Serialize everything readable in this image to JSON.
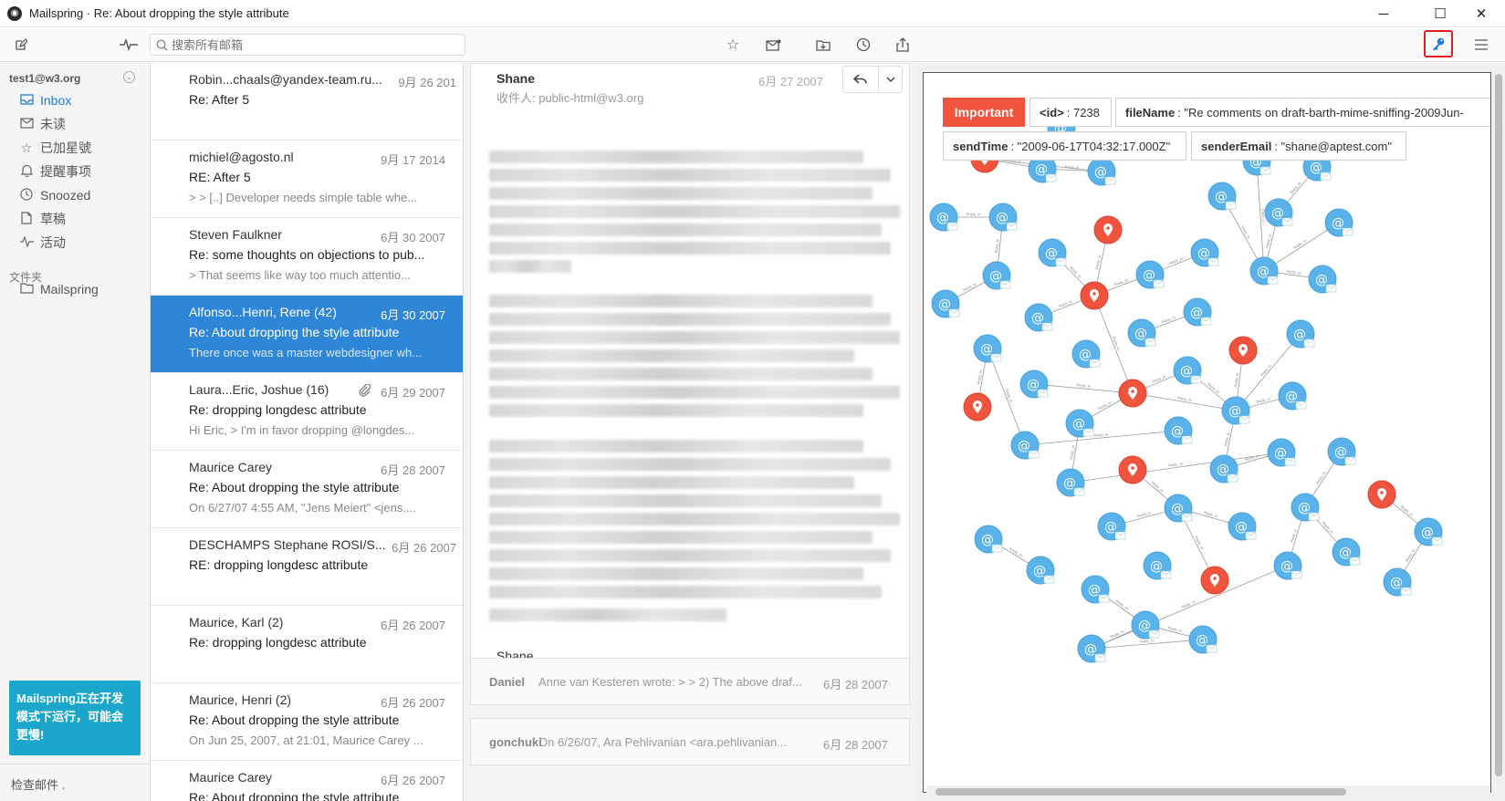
{
  "window": {
    "title": "Mailspring · Re: About dropping the style attribute",
    "minimize": "─",
    "maximize": "☐",
    "close": "✕"
  },
  "toolbar": {
    "compose_icon": "compose-icon",
    "activity_icon": "activity-icon",
    "search_placeholder": "搜索所有邮箱",
    "star_icon": "star-icon",
    "mail_icon": "mail-icon",
    "folder_icon": "folder-icon",
    "clock_icon": "clock-icon",
    "share_icon": "share-icon",
    "key_icon": "key-icon",
    "menu_icon": "menu-icon"
  },
  "sidebar": {
    "account": "test1@w3.org",
    "items": [
      {
        "label": "Inbox",
        "icon": "inbox-icon",
        "active": true
      },
      {
        "label": "未读",
        "icon": "unread-icon"
      },
      {
        "label": "已加星號",
        "icon": "star-icon"
      },
      {
        "label": "提醒事项",
        "icon": "bell-icon"
      },
      {
        "label": "Snoozed",
        "icon": "clock-icon"
      },
      {
        "label": "草稿",
        "icon": "draft-icon"
      },
      {
        "label": "活动",
        "icon": "activity-icon"
      }
    ],
    "folders_label": "文件夹",
    "folders": [
      {
        "label": "Mailspring",
        "icon": "folder-icon"
      }
    ],
    "dev_notice": "Mailspring正在开发模式下运行，可能会更慢!",
    "footer": "检查邮件 ."
  },
  "threads": [
    {
      "from": "Robin...chaals@yandex-team.ru...",
      "date": "9月 26 201",
      "subject": "Re: After 5",
      "snippet": ""
    },
    {
      "from": "michiel@agosto.nl",
      "date": "9月 17 2014",
      "subject": "RE: After 5",
      "snippet": "> > [..] Developer needs simple table whe..."
    },
    {
      "from": "Steven Faulkner",
      "date": "6月 30 2007",
      "subject": "Re: some thoughts on objections to pub...",
      "snippet": "> That seems like way too much attentio..."
    },
    {
      "from": "Alfonso...Henri, Rene (42)",
      "date": "6月 30 2007",
      "subject": "Re: About dropping the style attribute",
      "snippet": "There once was a master webdesigner wh...",
      "selected": true
    },
    {
      "from": "Laura...Eric, Joshue (16)",
      "date": "6月 29 2007",
      "subject": "Re: dropping longdesc attribute",
      "snippet": "Hi Eric, > I'm in favor dropping @longdes...",
      "attachment": true
    },
    {
      "from": "Maurice Carey",
      "date": "6月 28 2007",
      "subject": "Re: About dropping the style attribute",
      "snippet": "On 6/27/07 4:55 AM, \"Jens Meiert\" <jens...."
    },
    {
      "from": "DESCHAMPS Stephane ROSI/S...",
      "date": "6月 26 2007",
      "subject": "RE: dropping longdesc attribute",
      "snippet": ""
    },
    {
      "from": "Maurice, Karl (2)",
      "date": "6月 26 2007",
      "subject": "Re: dropping longdesc attribute",
      "snippet": ""
    },
    {
      "from": "Maurice, Henri (2)",
      "date": "6月 26 2007",
      "subject": "Re: About dropping the style attribute",
      "snippet": "On Jun 25, 2007, at 21:01, Maurice Carey ..."
    },
    {
      "from": "Maurice Carey",
      "date": "6月 26 2007",
      "subject": "Re: About dropping the style attribute",
      "snippet": ""
    }
  ],
  "message": {
    "sender": "Shane",
    "to": "收件人: public-html@w3.org",
    "date": "6月 27 2007",
    "reply_icon": "reply-icon",
    "dropdown_icon": "chevron-down-icon",
    "signature": "Shane"
  },
  "collapsed_messages": [
    {
      "from": "Daniel",
      "snippet": "Anne van Kesteren wrote: > > 2) The above draf...",
      "date": "6月 28 2007"
    },
    {
      "from": "gonchuki",
      "snippet": "On 6/26/07, Ara Pehlivanian <ara.pehlivanian...",
      "date": "6月 28 2007"
    }
  ],
  "graph": {
    "tag": "Important",
    "props": [
      {
        "key": "<id>",
        "value": ": 7238"
      },
      {
        "key": "fileName",
        "value": ": \"Re comments on draft-barth-mime-sniffing-2009Jun-"
      },
      {
        "key": "sendTime",
        "value": ": \"2009-06-17T04:32:17.000Z\""
      },
      {
        "key": "senderEmail",
        "value": ": \"shane@aptest.com\""
      }
    ],
    "email_glyph": "@",
    "edge_label": "Reply_to",
    "colors": {
      "email_node": "#59b3ea",
      "person_node": "#f0533e",
      "edge": "#9a9a9a"
    }
  }
}
